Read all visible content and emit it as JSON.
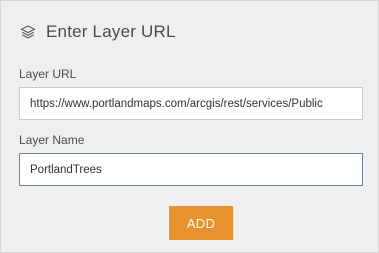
{
  "header": {
    "title": "Enter Layer URL",
    "icon": "layers-icon"
  },
  "form": {
    "url_label": "Layer URL",
    "url_value": "https://www.portlandmaps.com/arcgis/rest/services/Public",
    "name_label": "Layer Name",
    "name_value": "PortlandTrees",
    "add_label": "ADD"
  },
  "colors": {
    "accent": "#e8912f",
    "focus_border": "#6f86a6"
  }
}
